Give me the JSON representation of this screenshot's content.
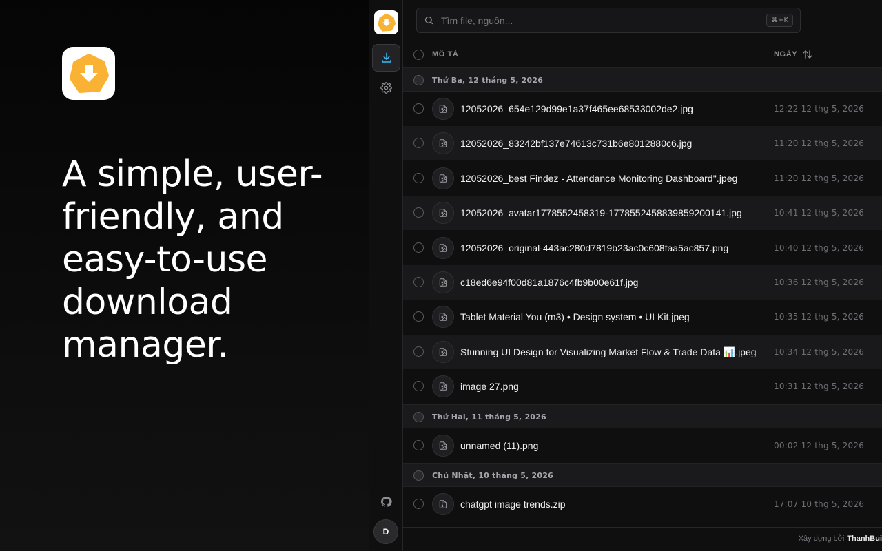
{
  "hero": {
    "title": "A simple, user-friendly, and easy-to-use download manager."
  },
  "colors": {
    "brand": "#F9B233",
    "accent": "#38BDF8",
    "background": "#0F0F10"
  },
  "rail": {
    "items": [
      {
        "name": "downloads",
        "icon": "download-icon",
        "active": true
      },
      {
        "name": "settings",
        "icon": "gear-icon",
        "active": false
      }
    ],
    "github_icon": "github-icon",
    "avatar_initial": "D"
  },
  "search": {
    "placeholder": "Tìm file, nguồn...",
    "shortcut": "⌘+K"
  },
  "table": {
    "col_description": "MÔ TẢ",
    "col_date": "NGÀY",
    "groups": [
      {
        "label": "Thứ Ba, 12 tháng 5, 2026",
        "rows": [
          {
            "name": "12052026_654e129d99e1a37f465ee68533002de2.jpg",
            "date": "12:22 12 thg 5, 2026",
            "icon": "image-file-icon"
          },
          {
            "name": "12052026_83242bf137e74613c731b6e8012880c6.jpg",
            "date": "11:20 12 thg 5, 2026",
            "icon": "image-file-icon"
          },
          {
            "name": "12052026_best Findez - Attendance Monitoring Dashboard''.jpeg",
            "date": "11:20 12 thg 5, 2026",
            "icon": "image-file-icon"
          },
          {
            "name": "12052026_avatar1778552458319-1778552458839859200141.jpg",
            "date": "10:41 12 thg 5, 2026",
            "icon": "image-file-icon"
          },
          {
            "name": "12052026_original-443ac280d7819b23ac0c608faa5ac857.png",
            "date": "10:40 12 thg 5, 2026",
            "icon": "image-file-icon"
          },
          {
            "name": "c18ed6e94f00d81a1876c4fb9b00e61f.jpg",
            "date": "10:36 12 thg 5, 2026",
            "icon": "image-file-icon"
          },
          {
            "name": "Tablet Material You (m3) • Design system • UI Kit.jpeg",
            "date": "10:35 12 thg 5, 2026",
            "icon": "image-file-icon"
          },
          {
            "name": "Stunning UI Design for Visualizing Market Flow & Trade Data 📊.jpeg",
            "date": "10:34 12 thg 5, 2026",
            "icon": "image-file-icon"
          },
          {
            "name": "image 27.png",
            "date": "10:31 12 thg 5, 2026",
            "icon": "image-file-icon"
          }
        ]
      },
      {
        "label": "Thứ Hai, 11 tháng 5, 2026",
        "rows": [
          {
            "name": "unnamed (11).png",
            "date": "00:02 12 thg 5, 2026",
            "icon": "image-file-icon"
          }
        ]
      },
      {
        "label": "Chủ Nhật, 10 tháng 5, 2026",
        "rows": [
          {
            "name": "chatgpt image trends.zip",
            "date": "17:07 10 thg 5, 2026",
            "icon": "archive-file-icon"
          }
        ]
      }
    ]
  },
  "footer": {
    "built_by": "Xây dựng bởi",
    "author": "ThanhBui"
  }
}
